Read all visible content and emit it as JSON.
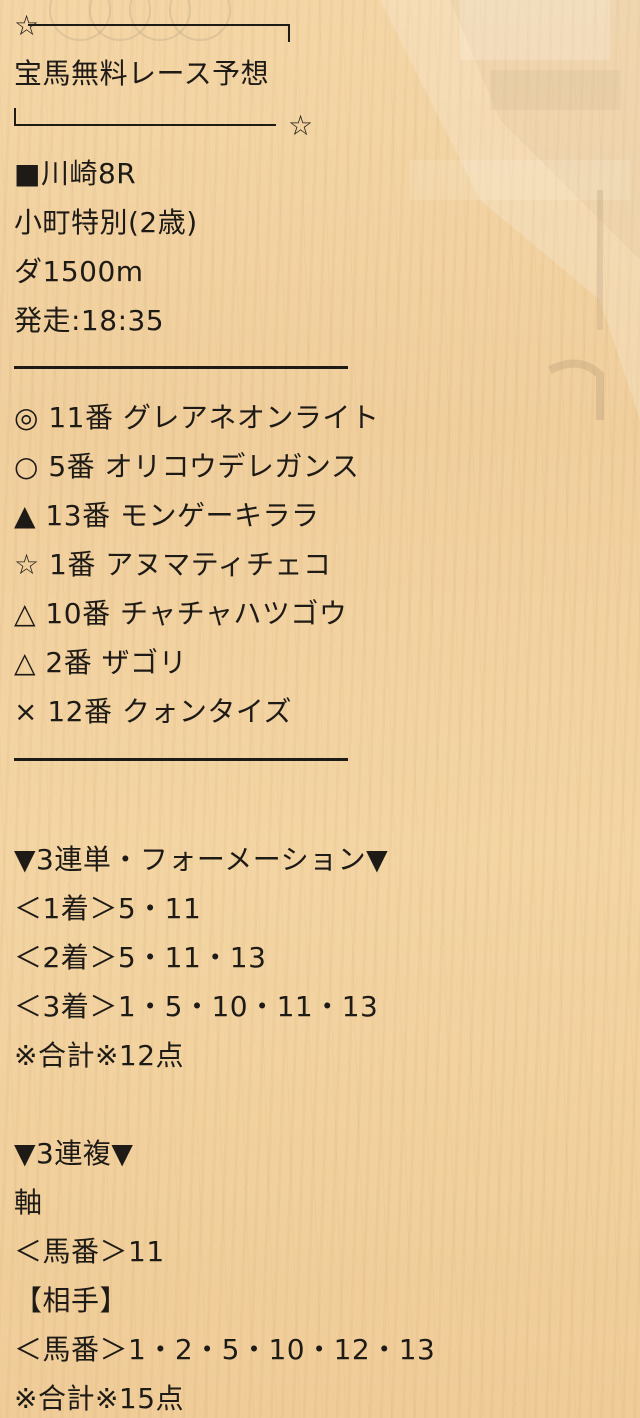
{
  "header": {
    "star_left": "☆",
    "star_right": "☆",
    "title": "宝馬無料レース予想"
  },
  "race": {
    "venue": "■川崎8R",
    "name": "小町特別(2歳)",
    "distance": "ダ1500m",
    "start": "発走:18:35"
  },
  "picks": [
    "◎ 11番 グレアネオンライト",
    "○ 5番 オリコウデレガンス",
    "▲ 13番 モンゲーキララ",
    "☆ 1番 アヌマティチェコ",
    "△ 10番 チャチャハツゴウ",
    "△ 2番 ザゴリ",
    "× 12番 クォンタイズ"
  ],
  "trifecta": {
    "heading": "▼3連単・フォーメーション▼",
    "first": "＜1着＞5・11",
    "second": "＜2着＞5・11・13",
    "third": "＜3着＞1・5・10・11・13",
    "total": "※合計※12点"
  },
  "trio": {
    "heading": "▼3連複▼",
    "axis_label": "軸",
    "axis": "＜馬番＞11",
    "partner_label": "【相手】",
    "partners": "＜馬番＞1・2・5・10・12・13",
    "total": "※合計※15点"
  }
}
